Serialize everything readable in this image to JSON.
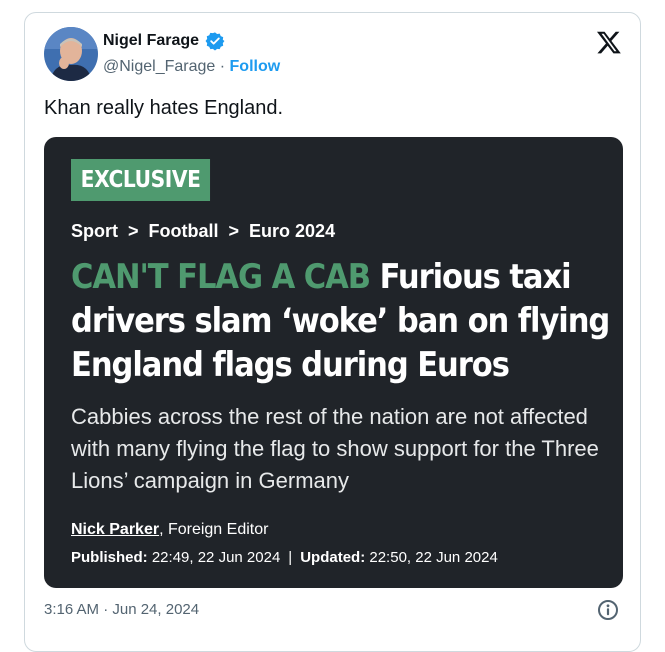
{
  "tweet": {
    "author_name": "Nigel Farage",
    "handle": "@Nigel_Farage",
    "separator": "·",
    "follow_label": "Follow",
    "text": "Khan really hates England.",
    "timestamp": "3:16 AM · Jun 24, 2024"
  },
  "article": {
    "tag": "EXCLUSIVE",
    "breadcrumbs": [
      "Sport",
      "Football",
      "Euro 2024"
    ],
    "breadcrumb_separator": ">",
    "headline_kicker": "CAN'T FLAG A CAB",
    "headline_rest": "Furious taxi drivers slam ‘woke’ ban on flying England flags during Euros",
    "standfirst": "Cabbies across the rest of the nation are not affected with many flying the flag to show support for the Three Lions’ campaign in Germany",
    "byline_author": "Nick Parker",
    "byline_role": ", Foreign Editor",
    "published_label": "Published:",
    "published_value": " 22:49, 22 Jun 2024",
    "updated_label": "Updated:",
    "updated_value": " 22:50, 22 Jun 2024",
    "date_separator": "|"
  },
  "icons": {
    "verified": "verified-badge-icon",
    "x_logo": "x-logo-icon",
    "info": "info-icon"
  },
  "colors": {
    "follow": "#1d9bf0",
    "verified": "#1d9bf0",
    "card_bg": "#202429",
    "accent_green": "#4f9a6f"
  }
}
